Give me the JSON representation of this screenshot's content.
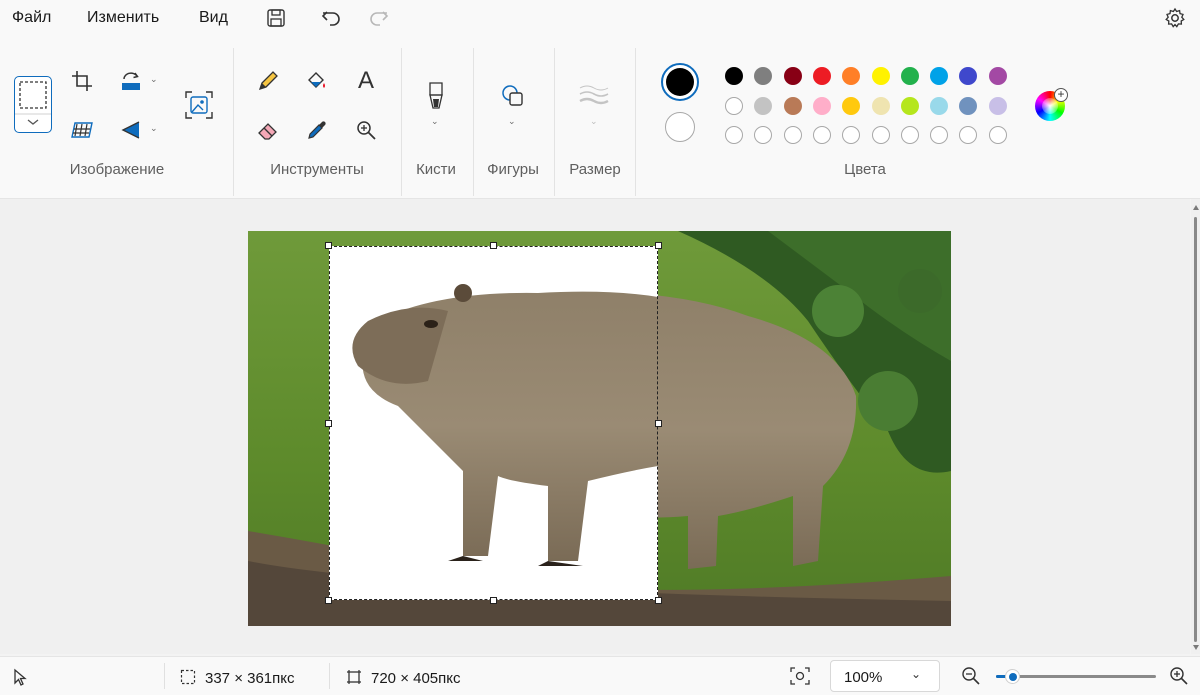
{
  "menu": {
    "file": "Файл",
    "edit": "Изменить",
    "view": "Вид"
  },
  "quick_access": [
    "save-icon",
    "undo-icon",
    "redo-icon"
  ],
  "ribbon": {
    "groups": {
      "image": "Изображение",
      "tools": "Инструменты",
      "brushes": "Кисти",
      "shapes": "Фигуры",
      "size": "Размер",
      "colors": "Цвета"
    },
    "text_tool_glyph": "A"
  },
  "colors": {
    "primary": "#000000",
    "secondary": "#ffffff",
    "row1": [
      "#000000",
      "#7f7f7f",
      "#880015",
      "#ed1c24",
      "#ff7f27",
      "#fff200",
      "#22b14c",
      "#00a2e8",
      "#3f48cc",
      "#a349a4"
    ],
    "row2": [
      "#ffffff",
      "#c3c3c3",
      "#b97a57",
      "#ffaec9",
      "#ffc90e",
      "#efe4b0",
      "#b5e61d",
      "#99d9ea",
      "#7092be",
      "#c8bfe7"
    ],
    "row3_empty_count": 10
  },
  "status": {
    "selection_size": "337 × 361пкс",
    "canvas_size": "720 × 405пкс",
    "zoom": "100%",
    "zoom_slider_fraction": 0.1
  }
}
